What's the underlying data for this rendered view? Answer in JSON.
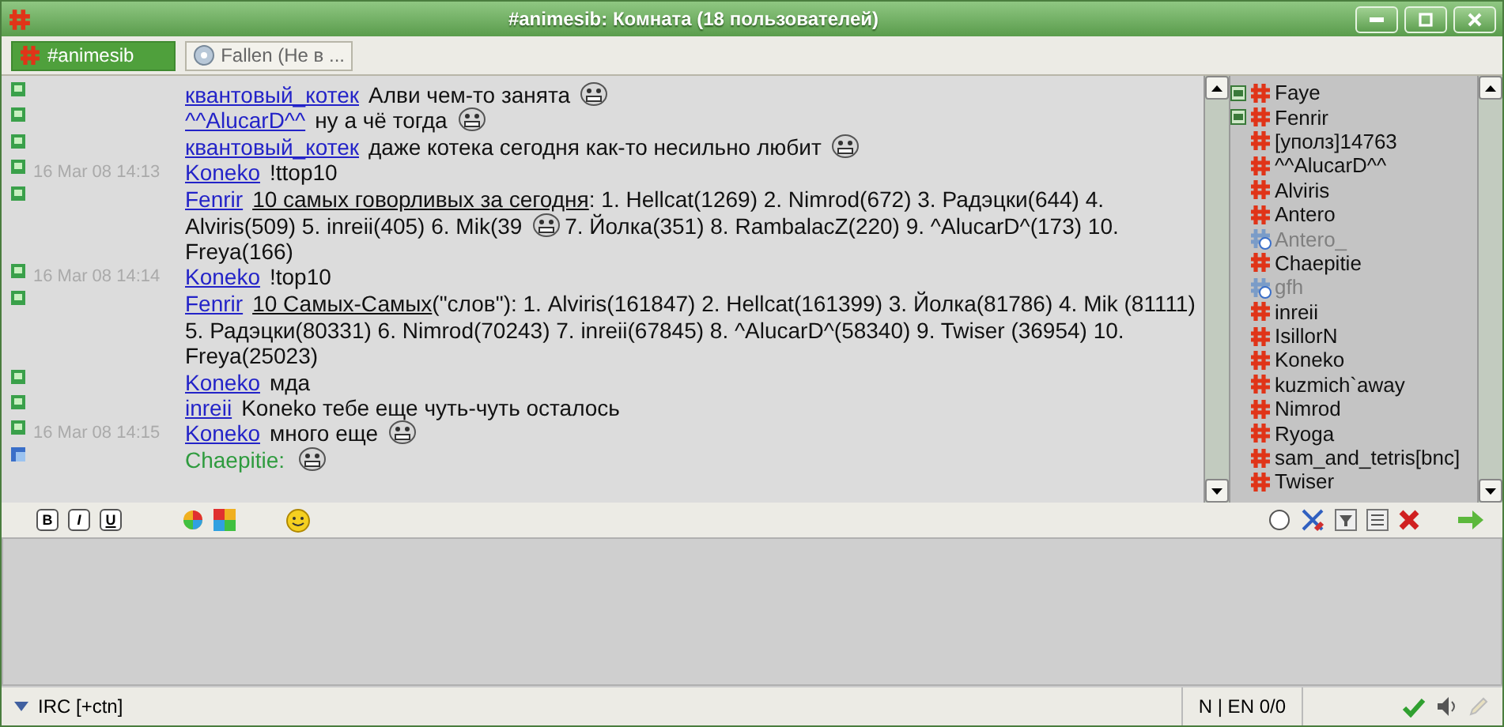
{
  "window": {
    "title": "#animesib: Комната (18 пользователей)"
  },
  "tabs": [
    {
      "label": "#animesib",
      "kind": "channel",
      "selected": true
    },
    {
      "label": "Fallen (Не в ...",
      "kind": "contact",
      "selected": false
    }
  ],
  "messages": [
    {
      "kind": "message",
      "nick": "квантовый_котек",
      "parts": [
        {
          "kind": "text",
          "text": "Алви чем-то занята"
        },
        {
          "kind": "emoticon"
        }
      ]
    },
    {
      "kind": "message",
      "nick": "^^AlucarD^^",
      "parts": [
        {
          "kind": "text",
          "text": "ну а чё тогда"
        },
        {
          "kind": "emoticon"
        }
      ]
    },
    {
      "kind": "message",
      "nick": "квантовый_котек",
      "parts": [
        {
          "kind": "text",
          "text": "даже котека сегодня как-то несильно любит"
        },
        {
          "kind": "emoticon"
        }
      ]
    },
    {
      "kind": "message",
      "time": "16 Mar 08 14:13",
      "nick": "Koneko",
      "parts": [
        {
          "kind": "text",
          "text": "!ttop10"
        }
      ]
    },
    {
      "kind": "message",
      "nick": "Fenrir",
      "parts": [
        {
          "kind": "underlined",
          "text": "10 самых говорливых за сегодня"
        },
        {
          "kind": "text",
          "text": ": 1. Hellcat(1269) 2. Nimrod(672) 3. Радэцки(644) 4. Alviris(509) 5. inreii(405) 6. Mik(39"
        },
        {
          "kind": "emoticon"
        },
        {
          "kind": "text",
          "text": "7. Йолка(351) 8. RambalacZ(220) 9. ^AlucarD^(173) 10. Freya(166)"
        }
      ]
    },
    {
      "kind": "message",
      "time": "16 Mar 08 14:14",
      "nick": "Koneko",
      "parts": [
        {
          "kind": "text",
          "text": "!top10"
        }
      ]
    },
    {
      "kind": "message",
      "nick": "Fenrir",
      "parts": [
        {
          "kind": "underlined",
          "text": "10 Самых-Самых"
        },
        {
          "kind": "text",
          "text": "(\"слов\"): 1. Alviris(161847) 2. Hellcat(161399) 3. Йолка(81786) 4. Mik (81111) 5. Радэцки(80331) 6. Nimrod(70243) 7. inreii(67845) 8. ^AlucarD^(58340) 9. Twiser (36954) 10. Freya(25023)"
        }
      ]
    },
    {
      "kind": "message",
      "nick": "Koneko",
      "parts": [
        {
          "kind": "text",
          "text": "мда"
        }
      ]
    },
    {
      "kind": "message",
      "nick": "inreii",
      "parts": [
        {
          "kind": "text",
          "text": "Koneko тебе еще чуть-чуть осталось"
        }
      ]
    },
    {
      "kind": "message",
      "time": "16 Mar 08 14:15",
      "nick": "Koneko",
      "parts": [
        {
          "kind": "text",
          "text": "много еще"
        },
        {
          "kind": "emoticon"
        }
      ]
    },
    {
      "kind": "status",
      "nick": "Chaepitie:",
      "parts": [
        {
          "kind": "emoticon"
        }
      ]
    }
  ],
  "users": [
    {
      "name": "Faye",
      "kind": "op"
    },
    {
      "name": "Fenrir",
      "kind": "op"
    },
    {
      "name": "[уполз]14763",
      "kind": "normal"
    },
    {
      "name": "^^AlucarD^^",
      "kind": "normal"
    },
    {
      "name": "Alviris",
      "kind": "normal"
    },
    {
      "name": "Antero",
      "kind": "normal"
    },
    {
      "name": "Antero_",
      "kind": "away"
    },
    {
      "name": "Chaepitie",
      "kind": "normal"
    },
    {
      "name": "gfh",
      "kind": "away"
    },
    {
      "name": "inreii",
      "kind": "normal"
    },
    {
      "name": "IsillorN",
      "kind": "normal"
    },
    {
      "name": "Koneko",
      "kind": "normal"
    },
    {
      "name": "kuzmich`away",
      "kind": "normal"
    },
    {
      "name": "Nimrod",
      "kind": "normal"
    },
    {
      "name": "Ryoga",
      "kind": "normal"
    },
    {
      "name": "sam_and_tetris[bnc]",
      "kind": "normal"
    },
    {
      "name": "Twiser",
      "kind": "normal"
    }
  ],
  "format_buttons": [
    "B",
    "I",
    "U"
  ],
  "status_bar": {
    "account": "IRC [+ctn]",
    "layout": "N | EN 0/0"
  }
}
